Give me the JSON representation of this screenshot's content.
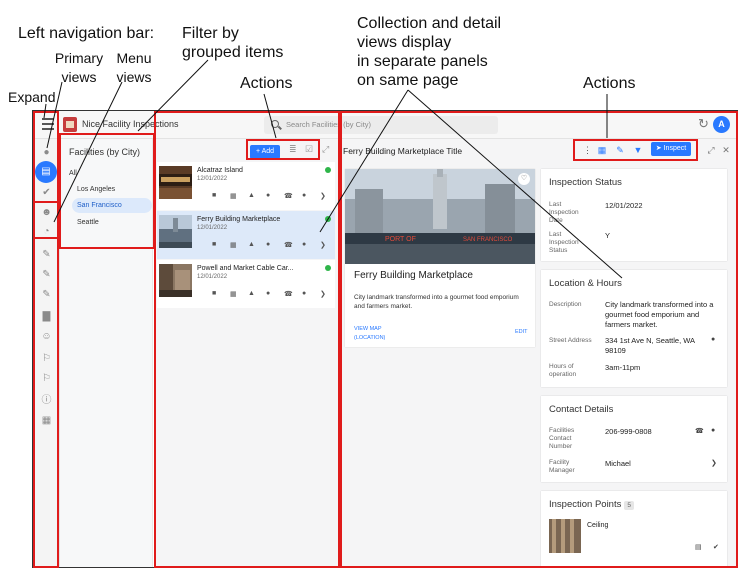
{
  "annotations": {
    "left_nav_bar": "Left navigation bar:",
    "primary_views": "Primary\nviews",
    "menu_views": "Menu\nviews",
    "expand": "Expand",
    "filter": "Filter by\ngrouped items",
    "actions_left": "Actions",
    "collection": "Collection and detail\nviews display\nin separate panels\non same page",
    "actions_right": "Actions"
  },
  "app": {
    "title": "Nice Facility Inspections",
    "search_placeholder": "Search Facilities (by City)",
    "avatar_initial": "A"
  },
  "nav": {
    "icons": [
      "location-icon",
      "clipboard-icon",
      "check-list-icon",
      "people-icon",
      "gauge-icon",
      "edit-icon",
      "edit-icon",
      "edit-icon",
      "chart-icon",
      "group-icon",
      "pin-icon",
      "pin-icon",
      "info-icon",
      "grid-icon"
    ]
  },
  "filter": {
    "heading": "Facilities (by City)",
    "items": [
      "All",
      "Los Angeles",
      "San Francisco",
      "Seattle"
    ],
    "selected": "San Francisco"
  },
  "list": {
    "add_label": "+ Add",
    "items": [
      {
        "title": "Alcatraz Island",
        "date": "12/01/2022"
      },
      {
        "title": "Ferry Building Marketplace",
        "date": "12/01/2022"
      },
      {
        "title": "Powell and Market Cable Car...",
        "date": "12/01/2022"
      }
    ],
    "selected_index": 1
  },
  "detail": {
    "title": "Ferry Building Marketplace Title",
    "inspect_label": "Inspect",
    "hero": {
      "name": "Ferry Building Marketplace",
      "description": "City landmark transformed into a gourmet food emporium and farmers market.",
      "view_map": "VIEW MAP\n(LOCATION)",
      "edit": "EDIT",
      "sign_left": "PORT OF",
      "sign_right": "SAN FRANCISCO"
    },
    "inspection_status": {
      "heading": "Inspection Status",
      "last_date_label": "Last\nInspection\nDate",
      "last_date_value": "12/01/2022",
      "last_status_label": "Last\nInspection\nStatus",
      "last_status_value": "Y"
    },
    "location": {
      "heading": "Location & Hours",
      "description_label": "Description",
      "description_value": "City landmark transformed into a gourmet food emporium and farmers market.",
      "street_label": "Street Address",
      "street_value": "334 1st Ave N, Seattle, WA 98109",
      "hours_label": "Hours of\noperation",
      "hours_value": "3am-11pm"
    },
    "contact": {
      "heading": "Contact Details",
      "phone_label": "Facilities\nContact\nNumber",
      "phone_value": "206-999-0808",
      "manager_label": "Facility\nManager",
      "manager_value": "Michael"
    },
    "inspection_points": {
      "heading": "Inspection Points",
      "count": "5",
      "first_item": "Ceiling"
    }
  },
  "colors": {
    "accent": "#2979ff",
    "highlight": "#e01b1b",
    "status_ok": "#2fb54a"
  }
}
